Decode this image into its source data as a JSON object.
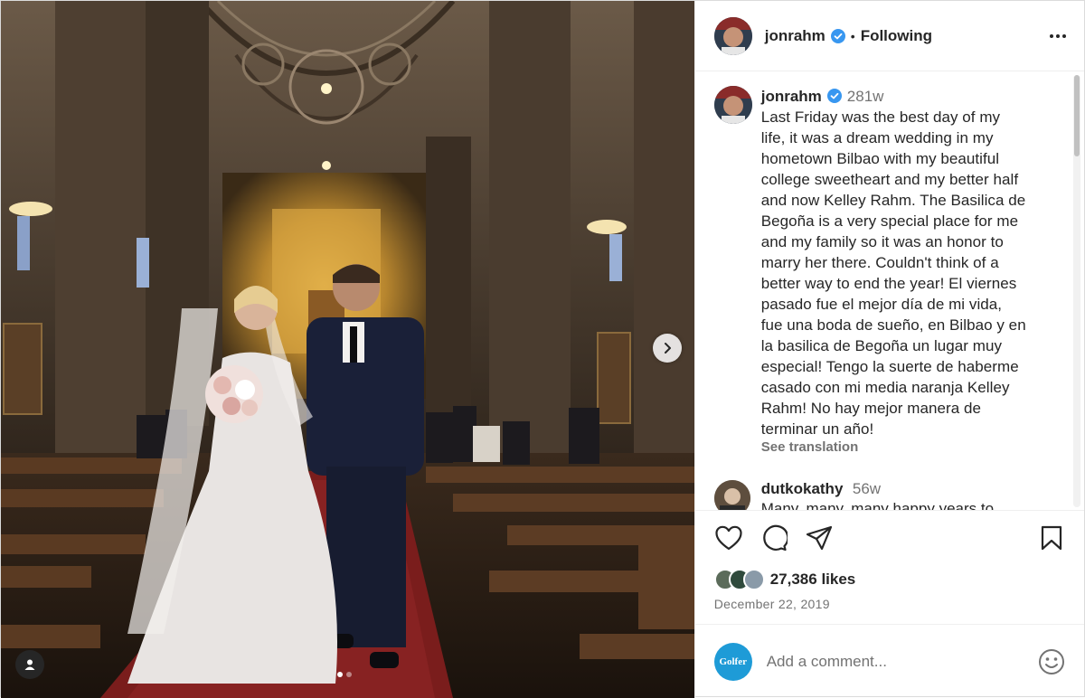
{
  "post": {
    "author": "jonrahm",
    "follow_state": "Following",
    "separator": "•",
    "caption_time": "281w",
    "caption": "Last Friday was the best day of my\nlife, it was a dream wedding in my\nhometown Bilbao with my beautiful\ncollege sweetheart and my better half\nand now Kelley Rahm. The Basilica de\nBegoña is a very special place for me\nand my family so it was an honor to\nmarry her there. Couldn't think of a\nbetter way to end the year! El viernes\npasado fue el mejor día de mi vida,\nfue una boda de sueño, en Bilbao y en\nla basilica de Begoña un lugar muy\nespecial! Tengo la suerte de haberme\ncasado con mi media naranja Kelley\nRahm! No hay mejor manera de\nterminar un año!",
    "see_translation": "See translation",
    "likes": "27,386 likes",
    "date": "December 22, 2019"
  },
  "comments": [
    {
      "user": "dutkokathy",
      "time": "56w",
      "text": "Many, many, many happy years to"
    }
  ],
  "composer": {
    "placeholder": "Add a comment...",
    "avatar_label": "Golfer"
  },
  "carousel": {
    "slide_count": 2,
    "active_index": 0
  },
  "icons": {
    "heart": "heart-icon",
    "comment": "comment-icon",
    "share": "share-icon",
    "bookmark": "bookmark-icon",
    "more": "more-options-icon",
    "next": "chevron-right-icon",
    "tag": "user-tag-icon",
    "emoji": "emoji-icon",
    "verified": "verified-badge-icon"
  },
  "colors": {
    "verified": "#3897f0",
    "text": "#262626",
    "muted": "#737373",
    "golfer_brand": "#1e9bd7"
  }
}
